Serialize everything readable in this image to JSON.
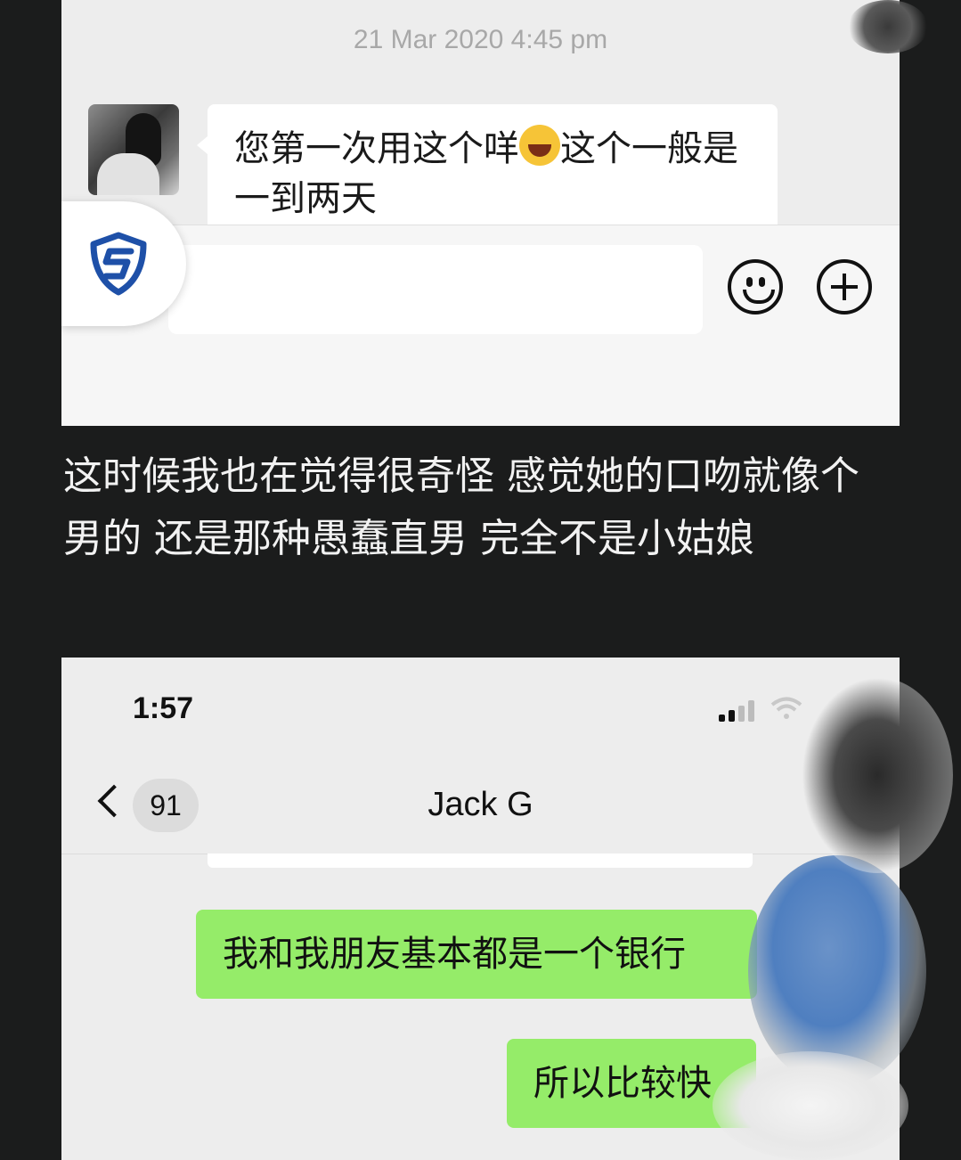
{
  "top_screenshot": {
    "timestamp": "21 Mar 2020 4:45 pm",
    "incoming_message": {
      "text_before_emoji": "您第一次用这个咩",
      "emoji": "😂",
      "text_after_emoji": "这个一般是一到两天"
    },
    "input_placeholder": "",
    "icons": [
      "shield-logo-icon",
      "emoji-face-icon",
      "plus-icon"
    ]
  },
  "narration": "这时候我也在觉得很奇怪 感觉她的口吻就像个男的 还是那种愚蠢直男 完全不是小姑娘",
  "bottom_screenshot": {
    "status_bar": {
      "time": "1:57"
    },
    "nav": {
      "unread_count": "91",
      "title": "Jack G"
    },
    "outgoing_messages": [
      "我和我朋友基本都是一个银行",
      "所以比较快"
    ]
  },
  "colors": {
    "background": "#1b1c1c",
    "chat_bg": "#ededed",
    "outgoing_bubble": "#95ec69",
    "incoming_bubble": "#ffffff",
    "shield_blue": "#1e50a8"
  }
}
